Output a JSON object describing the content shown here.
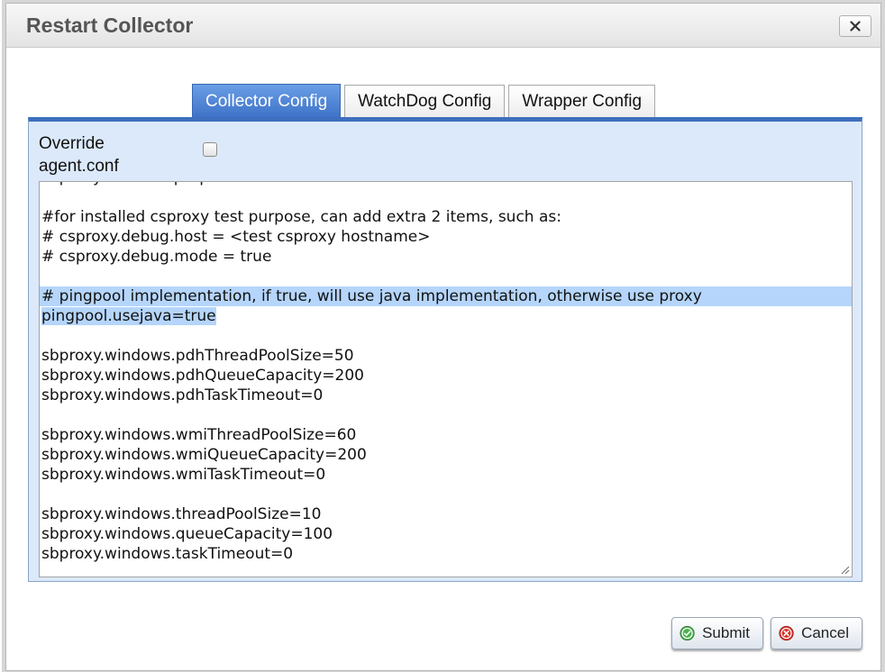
{
  "dialog": {
    "title": "Restart Collector",
    "close_label": "×"
  },
  "tabs": [
    {
      "label": "Collector Config",
      "active": true
    },
    {
      "label": "WatchDog Config",
      "active": false
    },
    {
      "label": "Wrapper Config",
      "active": false
    }
  ],
  "override": {
    "label": "Override agent.conf",
    "checked": false
  },
  "config_text": {
    "lines": [
      "# proxy items ... purpose",
      "",
      "#for installed csproxy test purpose, can add extra 2 items, such as:",
      "# csproxy.debug.host = <test csproxy hostname>",
      "# csproxy.debug.mode = true",
      "",
      "# pingpool implementation, if true, will use java implementation, otherwise use proxy",
      "pingpool.usejava=true",
      "",
      "sbproxy.windows.pdhThreadPoolSize=50",
      "sbproxy.windows.pdhQueueCapacity=200",
      "sbproxy.windows.pdhTaskTimeout=0",
      "",
      "sbproxy.windows.wmiThreadPoolSize=60",
      "sbproxy.windows.wmiQueueCapacity=200",
      "sbproxy.windows.wmiTaskTimeout=0",
      "",
      "sbproxy.windows.threadPoolSize=10",
      "sbproxy.windows.queueCapacity=100",
      "sbproxy.windows.taskTimeout=0"
    ],
    "selected_line_indexes": [
      6,
      7
    ]
  },
  "buttons": {
    "submit_label": "Submit",
    "cancel_label": "Cancel"
  },
  "colors": {
    "tab_active": "#3d72c7",
    "panel_bg": "#dce9fb",
    "selection": "#b5d5fb",
    "submit_icon": "#4caf50",
    "cancel_icon": "#d9322b"
  },
  "icons": {
    "close": "close-icon",
    "submit": "check-circle-icon",
    "cancel": "x-circle-icon",
    "resize": "resize-grip-icon"
  }
}
